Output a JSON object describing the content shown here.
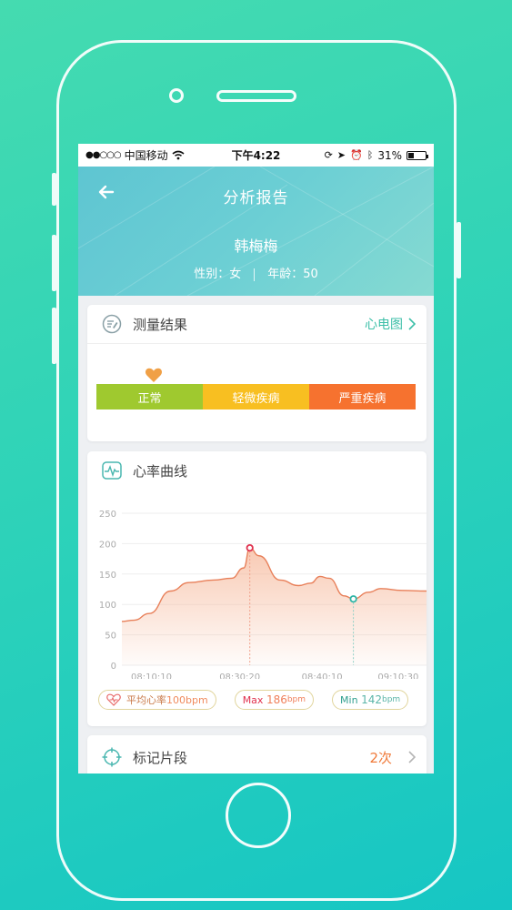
{
  "status": {
    "carrier": "中国移动",
    "time": "下午4:22",
    "battery": "31%",
    "battery_level": 0.31
  },
  "header": {
    "title": "分析报告",
    "name": "韩梅梅",
    "gender": "性别：女",
    "age": "年龄：50"
  },
  "result": {
    "title": "测量结果",
    "link": "心电图",
    "segments": [
      "正常",
      "轻微疾病",
      "严重疾病"
    ],
    "colors": [
      "#9fc92f",
      "#f8bf21",
      "#f6722f"
    ],
    "marker_icon": "heart-icon"
  },
  "heart_rate": {
    "title": "心率曲线",
    "icon": "ecg-monitor-icon",
    "avg_label": "平均心率",
    "avg_value": "100bpm",
    "max_label": "Max",
    "max_value": "186",
    "max_unit": "bpm",
    "min_label": "Min",
    "min_value": "142",
    "min_unit": "bpm"
  },
  "marks": {
    "title": "标记片段",
    "count": "2次",
    "icon": "target-icon"
  },
  "chart_data": {
    "type": "area",
    "x_ticks": [
      "08:10:10",
      "08:30:20",
      "08:40:10",
      "09:10:30"
    ],
    "y_ticks": [
      0,
      50,
      100,
      150,
      200,
      250
    ],
    "ylim": [
      0,
      250
    ],
    "grid": true,
    "points": [
      {
        "x": 0,
        "y": 72
      },
      {
        "x": 0.04,
        "y": 74
      },
      {
        "x": 0.09,
        "y": 85
      },
      {
        "x": 0.16,
        "y": 122
      },
      {
        "x": 0.22,
        "y": 136
      },
      {
        "x": 0.3,
        "y": 140
      },
      {
        "x": 0.36,
        "y": 143
      },
      {
        "x": 0.4,
        "y": 160
      },
      {
        "x": 0.42,
        "y": 193
      },
      {
        "x": 0.45,
        "y": 180
      },
      {
        "x": 0.52,
        "y": 140
      },
      {
        "x": 0.58,
        "y": 131
      },
      {
        "x": 0.62,
        "y": 135
      },
      {
        "x": 0.65,
        "y": 146
      },
      {
        "x": 0.68,
        "y": 143
      },
      {
        "x": 0.73,
        "y": 114
      },
      {
        "x": 0.76,
        "y": 109
      },
      {
        "x": 0.81,
        "y": 120
      },
      {
        "x": 0.85,
        "y": 126
      },
      {
        "x": 0.92,
        "y": 123
      },
      {
        "x": 1,
        "y": 122
      }
    ],
    "max_point": {
      "x": 0.42,
      "y": 193
    },
    "min_point": {
      "x": 0.76,
      "y": 109
    },
    "line_color": "#e8805a",
    "fill_color": "#f6b89a"
  }
}
